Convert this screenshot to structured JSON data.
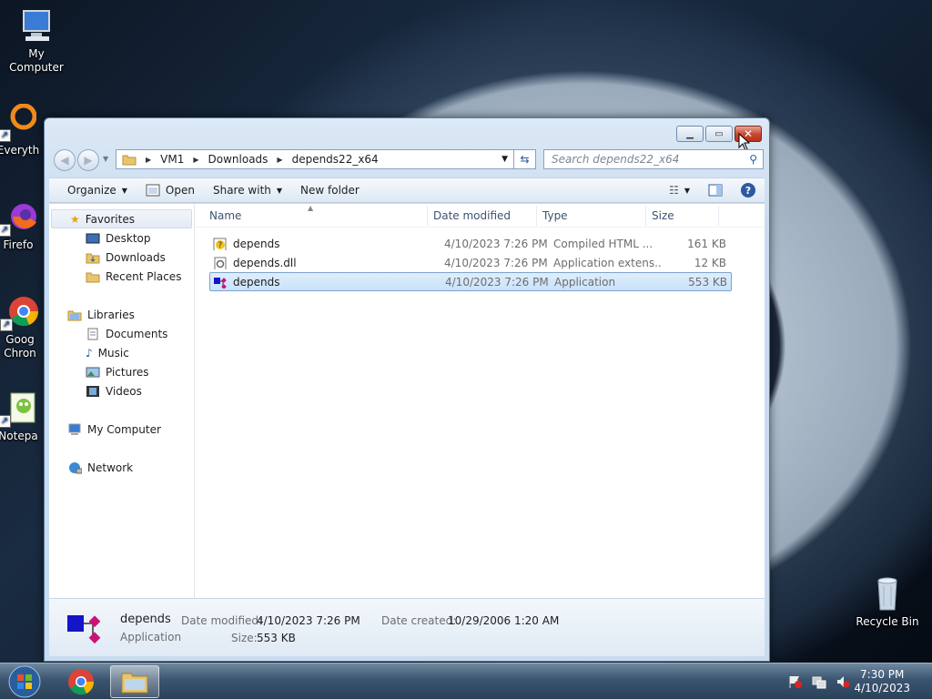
{
  "desktop": {
    "icons": [
      {
        "label": "My Computer",
        "icon": "computer-icon"
      },
      {
        "label": "Everyth",
        "icon": "everything-icon"
      },
      {
        "label": "Firefo",
        "icon": "firefox-icon"
      },
      {
        "label_line1": "Goog",
        "label_line2": "Chron",
        "icon": "chrome-icon"
      },
      {
        "label": "Notepa",
        "icon": "notepad-icon"
      },
      {
        "label": "Recycle Bin",
        "icon": "recycle-bin-icon"
      }
    ]
  },
  "window": {
    "breadcrumb": [
      "VM1",
      "Downloads",
      "depends22_x64"
    ],
    "search_placeholder": "Search depends22_x64",
    "toolbar": {
      "organize": "Organize",
      "open": "Open",
      "share_with": "Share with",
      "new_folder": "New folder"
    },
    "nav": {
      "favorites": "Favorites",
      "favorites_items": [
        "Desktop",
        "Downloads",
        "Recent Places"
      ],
      "libraries": "Libraries",
      "libraries_items": [
        "Documents",
        "Music",
        "Pictures",
        "Videos"
      ],
      "computer": "My Computer",
      "network": "Network"
    },
    "columns": {
      "name": "Name",
      "date": "Date modified",
      "type": "Type",
      "size": "Size"
    },
    "files": [
      {
        "name": "depends",
        "date": "4/10/2023 7:26 PM",
        "type": "Compiled HTML ...",
        "size": "161 KB",
        "icon": "chm-help-icon"
      },
      {
        "name": "depends.dll",
        "date": "4/10/2023 7:26 PM",
        "type": "Application extens...",
        "size": "12 KB",
        "icon": "dll-icon"
      },
      {
        "name": "depends",
        "date": "4/10/2023 7:26 PM",
        "type": "Application",
        "size": "553 KB",
        "icon": "app-icon",
        "selected": true
      }
    ],
    "details": {
      "name": "depends",
      "kind": "Application",
      "modified_label": "Date modified:",
      "modified_value": "4/10/2023 7:26 PM",
      "size_label": "Size:",
      "size_value": "553 KB",
      "created_label": "Date created:",
      "created_value": "10/29/2006 1:20 AM"
    }
  },
  "taskbar": {
    "time": "7:30 PM",
    "date": "4/10/2023"
  },
  "colors": {
    "selection": "#cce4fc",
    "close_button": "#c7462e",
    "taskbar": "#3b5470"
  }
}
